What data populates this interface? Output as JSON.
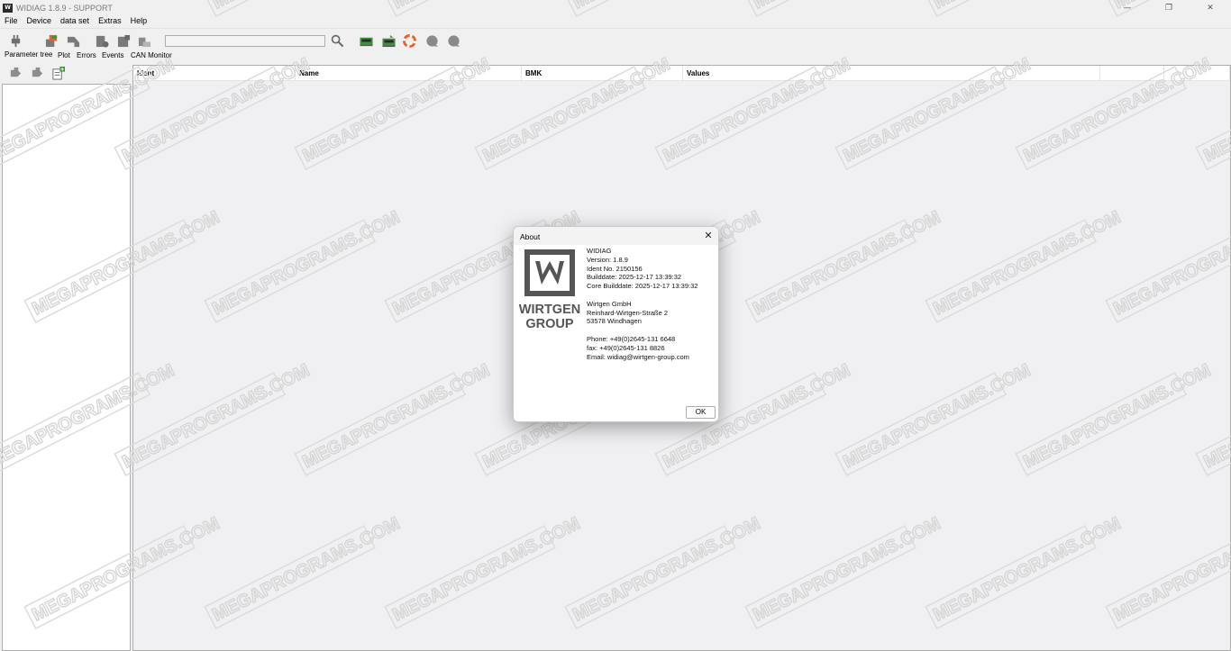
{
  "window": {
    "title": "WIDIAG 1.8.9 - SUPPORT",
    "app_icon_text": "W"
  },
  "menu": [
    "File",
    "Device",
    "data set",
    "Extras",
    "Help"
  ],
  "toolbar": {
    "labels": {
      "parameter_tree": "Parameter tree",
      "plot": "Plot",
      "errors": "Errors",
      "events": "Events",
      "can_monitor": "CAN Monitor"
    },
    "search_value": ""
  },
  "table": {
    "columns": [
      "Ident",
      "Name",
      "BMK",
      "Values",
      "",
      ""
    ]
  },
  "watermark_text": "MEGAPROGRAMS.COM",
  "about_dialog": {
    "title": "About",
    "logo_text_1": "WIRTGEN",
    "logo_text_2": "GROUP",
    "lines": {
      "product": "WIDIAG",
      "version": "Version: 1.8.9",
      "ident": "Ident No. 2150156",
      "builddate": "Builddate: 2025-12-17 13:39:32",
      "core_builddate": "Core Builddate: 2025-12-17 13:39:32",
      "company": "Wirtgen GmbH",
      "street": "Reinhard-Wirtgen-Straße 2",
      "city": "53578 Windhagen",
      "phone": "Phone: +49(0)2645-131 6648",
      "fax": "fax: +49(0)2645-131 8826",
      "email": "Email: widiag@wirtgen-group.com"
    },
    "ok_label": "OK"
  },
  "colors": {
    "accent_red": "#e8602c",
    "accent_green": "#3f8f3a",
    "logo_gray": "#555555"
  }
}
